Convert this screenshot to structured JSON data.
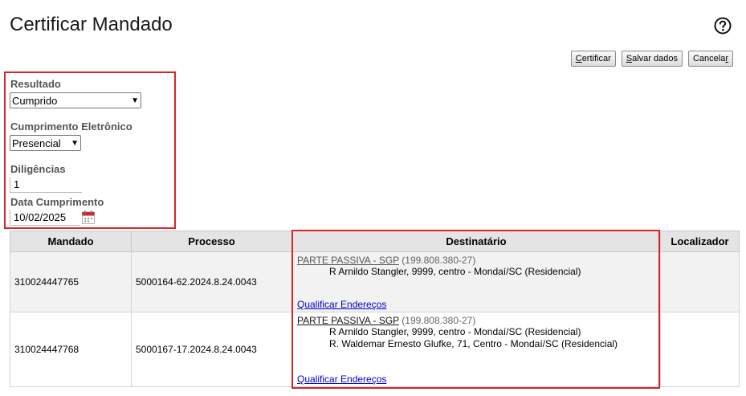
{
  "page": {
    "title": "Certificar Mandado"
  },
  "icons": {
    "help": "help-circle-icon",
    "calendar": "calendar-icon"
  },
  "colors": {
    "highlight": "#d9242b",
    "link": "#0000cc",
    "header_bg": "#e4e4e4"
  },
  "actions": {
    "certificar": {
      "pre": "",
      "ul": "C",
      "post": "ertificar"
    },
    "salvar": {
      "pre": "",
      "ul": "S",
      "post": "alvar dados"
    },
    "cancelar": {
      "pre": "Cancela",
      "ul": "r",
      "post": ""
    }
  },
  "form": {
    "resultado_label": "Resultado",
    "resultado_value": "Cumprido",
    "cumprimento_label": "Cumprimento Eletrônico",
    "cumprimento_value": "Presencial",
    "diligencias_label": "Diligências",
    "diligencias_value": "1",
    "data_label": "Data Cumprimento",
    "data_value": "10/02/2025"
  },
  "table": {
    "headers": [
      "Mandado",
      "Processo",
      "Destinatário",
      "Localizador"
    ],
    "rows": [
      {
        "mandado": "310024447765",
        "processo": "5000164-62.2024.8.24.0043",
        "party": "PARTE PASSIVA - SGP",
        "cpf": "(199.808.380-27)",
        "addresses": [
          "R Arnildo Stangler, 9999, centro - Mondaí/SC (Residencial)"
        ],
        "qualificar": "Qualificar Endereços",
        "localizador": ""
      },
      {
        "mandado": "310024447768",
        "processo": "5000167-17.2024.8.24.0043",
        "party": "PARTE PASSIVA - SGP",
        "cpf": "(199.808.380-27)",
        "addresses": [
          "R Arnildo Stangler, 9999, centro - Mondaí/SC (Residencial)",
          "R. Waldemar Ernesto Glufke, 71, Centro - Mondaí/SC (Residencial)"
        ],
        "qualificar": "Qualificar Endereços",
        "localizador": ""
      }
    ]
  }
}
